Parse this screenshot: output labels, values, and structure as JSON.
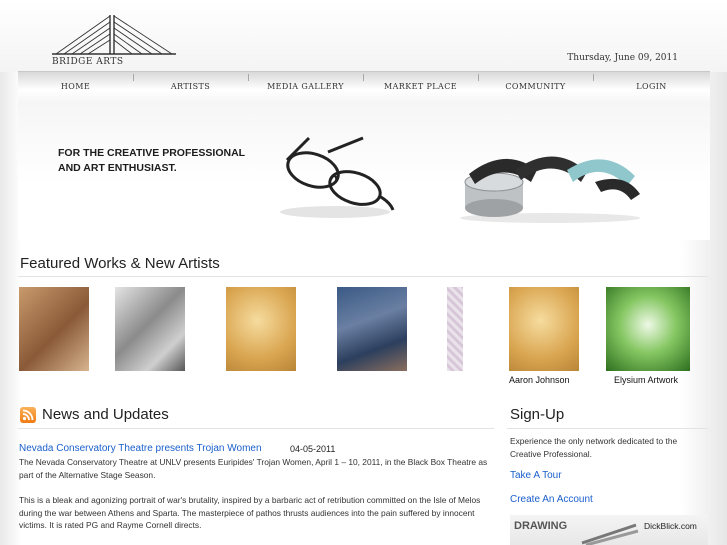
{
  "header": {
    "logo_text": "BRIDGE ARTS",
    "date": "Thursday, June 09, 2011"
  },
  "nav": {
    "items": [
      {
        "label": "HOME"
      },
      {
        "label": "ARTISTS"
      },
      {
        "label": "MEDIA GALLERY"
      },
      {
        "label": "MARKET PLACE"
      },
      {
        "label": "COMMUNITY"
      },
      {
        "label": "LOGIN"
      }
    ]
  },
  "banner": {
    "line1": "FOR THE CREATIVE PROFESSIONAL",
    "line2": "AND ART ENTHUSIAST."
  },
  "featured": {
    "title": "Featured Works & New Artists",
    "thumbs": [
      {
        "caption": ""
      },
      {
        "caption": ""
      },
      {
        "caption": ""
      },
      {
        "caption": ""
      },
      {
        "caption": ""
      },
      {
        "caption": "Aaron Johnson"
      },
      {
        "caption": "Elysium Artwork"
      }
    ]
  },
  "news": {
    "title": "News and Updates",
    "item": {
      "headline": "Nevada Conservatory Theatre presents Trojan Women",
      "date": "04-05-2011",
      "para1": "The Nevada Conservatory Theatre at UNLV presents Euripides' Trojan Women, April 1 – 10, 2011, in the Black Box Theatre as part of the Alternative Stage Season.",
      "para2": "This is a bleak and agonizing portrait of war's brutality, inspired by a barbaric act of retribution committed on the Isle of Melos during the war between Athens and Sparta. The masterpiece of pathos thrusts audiences into the pain suffered by innocent victims. It is rated PG and Rayme Cornell directs."
    }
  },
  "signup": {
    "title": "Sign-Up",
    "description": "Experience the only network dedicated to the Creative Professional.",
    "tour_link": "Take A Tour",
    "account_link": "Create An Account"
  },
  "ad": {
    "headline": "DRAWING",
    "brand": "DickBlick.com"
  }
}
